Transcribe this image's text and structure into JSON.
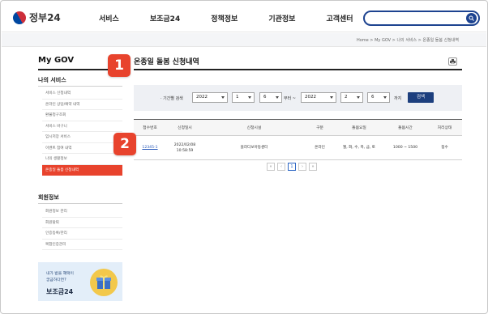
{
  "header": {
    "logo_text": "정부24",
    "nav": [
      "서비스",
      "보조금24",
      "정책정보",
      "기관정보",
      "고객센터"
    ],
    "search": {
      "value": "",
      "placeholder": ""
    }
  },
  "breadcrumb": "Home > My GOV > 나의 서비스 > 온종일 돌봄 신청내역",
  "sidebar": {
    "title": "My GOV",
    "section1": "나의 서비스",
    "items1": [
      "서비스 신청내역",
      "온라인 상담/예약 내역",
      "환불청구조회",
      "서비스 바구니",
      "임시저장 서비스",
      "이벤트 참여 내역",
      "나의 생활정보",
      "온종일 돌봄 신청내역"
    ],
    "active_index": 7,
    "section2": "회원정보",
    "items2": [
      "회원정보 관리",
      "회원탈퇴",
      "인증등록/관리",
      "복합인증관리"
    ],
    "promo": {
      "line1": "내가 받을 혜택이",
      "line2": "궁금하다면?",
      "title": "보조금24"
    }
  },
  "main": {
    "title": "온종일 돌봄 신청내역",
    "filter": {
      "period_label": "· 기간별 검색",
      "from_year": "2022",
      "from_month": "1",
      "from_day": "6",
      "from_suffix": "부터 ~",
      "to_year": "2022",
      "to_month": "2",
      "to_day": "6",
      "to_suffix": "까지",
      "search_button": "검색"
    },
    "table": {
      "headers": [
        "접수번호",
        "신청일시",
        "신청시설",
        "구분",
        "돌봄요일",
        "돌봄시간",
        "처리상태"
      ],
      "rows": [
        [
          "12345-1",
          "2022/02/08 10:58:59",
          "블라디보아동센터",
          "온라인",
          "월, 화, 수, 목, 금, 토",
          "1000 ~ 1500",
          "접수"
        ]
      ]
    },
    "pager": [
      "«",
      "‹",
      "1",
      "›",
      "»"
    ],
    "current_page": "1"
  },
  "callouts": [
    "1",
    "2"
  ],
  "colors": {
    "accent": "#e8432d",
    "brand": "#1d3f7e"
  }
}
